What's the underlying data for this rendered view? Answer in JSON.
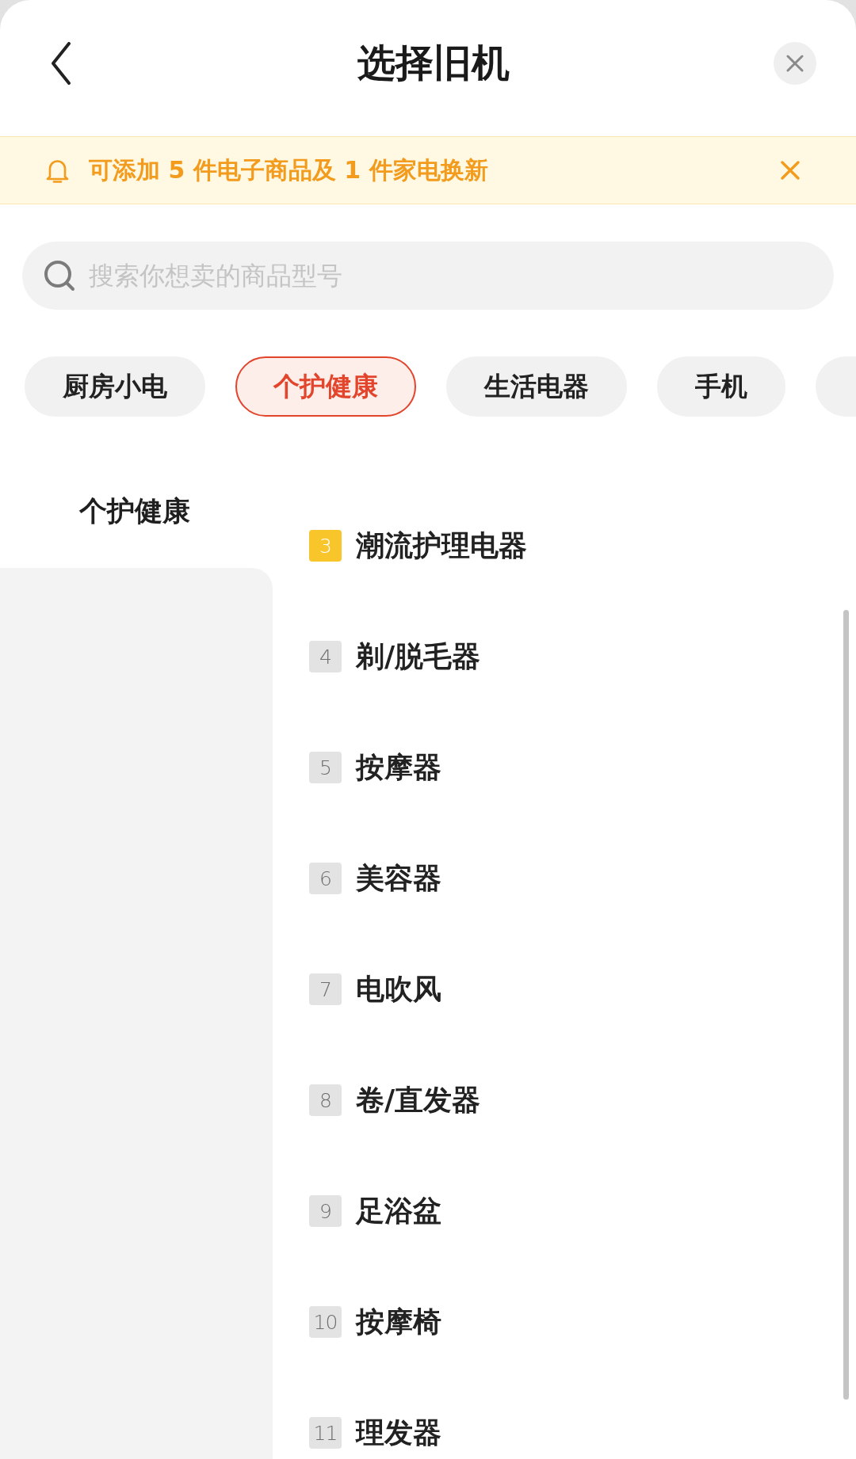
{
  "header": {
    "title": "选择旧机"
  },
  "notice": {
    "text": "可添加 5 件电子商品及 1 件家电换新"
  },
  "search": {
    "placeholder": "搜索你想卖的商品型号"
  },
  "categories": [
    {
      "label": "厨房小电",
      "selected": false
    },
    {
      "label": "个护健康",
      "selected": true
    },
    {
      "label": "生活电器",
      "selected": false
    },
    {
      "label": "手机",
      "selected": false
    }
  ],
  "sidebar": {
    "items": [
      {
        "label": "个护健康",
        "selected": true
      }
    ]
  },
  "items": [
    {
      "rank": "3",
      "name": "潮流护理电器",
      "color": "#f8c52a"
    },
    {
      "rank": "4",
      "name": "剃/脱毛器",
      "color": "#e3e3e3"
    },
    {
      "rank": "5",
      "name": "按摩器",
      "color": "#e3e3e3"
    },
    {
      "rank": "6",
      "name": "美容器",
      "color": "#e3e3e3"
    },
    {
      "rank": "7",
      "name": "电吹风",
      "color": "#e3e3e3"
    },
    {
      "rank": "8",
      "name": "卷/直发器",
      "color": "#e3e3e3"
    },
    {
      "rank": "9",
      "name": "足浴盆",
      "color": "#e3e3e3"
    },
    {
      "rank": "10",
      "name": "按摩椅",
      "color": "#e3e3e3"
    },
    {
      "rank": "11",
      "name": "理发器",
      "color": "#e3e3e3"
    }
  ]
}
